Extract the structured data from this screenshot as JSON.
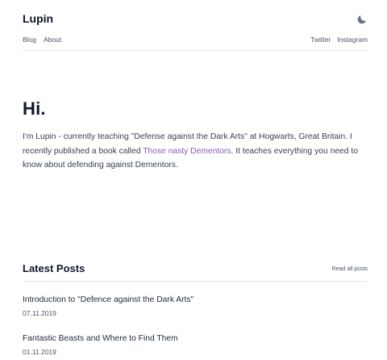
{
  "header": {
    "site_title": "Lupin",
    "theme_toggle_icon": "moon-icon",
    "nav_left": [
      "Blog",
      "About"
    ],
    "nav_right": [
      "Twitter",
      "Instagram"
    ]
  },
  "hero": {
    "heading": "Hi.",
    "intro_part1": "I'm Lupin - currently teaching \"Defense against the Dark Arts\" at Hogwarts, Great Britain. I recently published a book called ",
    "intro_link": "Those nasty Dementors",
    "intro_part2": ". It teaches everything you need to know about defending against Dementors.",
    "link_color": "#7c5cc4"
  },
  "latest_posts": {
    "heading": "Latest Posts",
    "read_all_label": "Read all posts",
    "posts": [
      {
        "title": "Introduction to \"Defence against the Dark Arts\"",
        "date": "07.11.2019"
      },
      {
        "title": "Fantastic Beasts and Where to Find Them",
        "date": "01.11.2019"
      }
    ]
  }
}
